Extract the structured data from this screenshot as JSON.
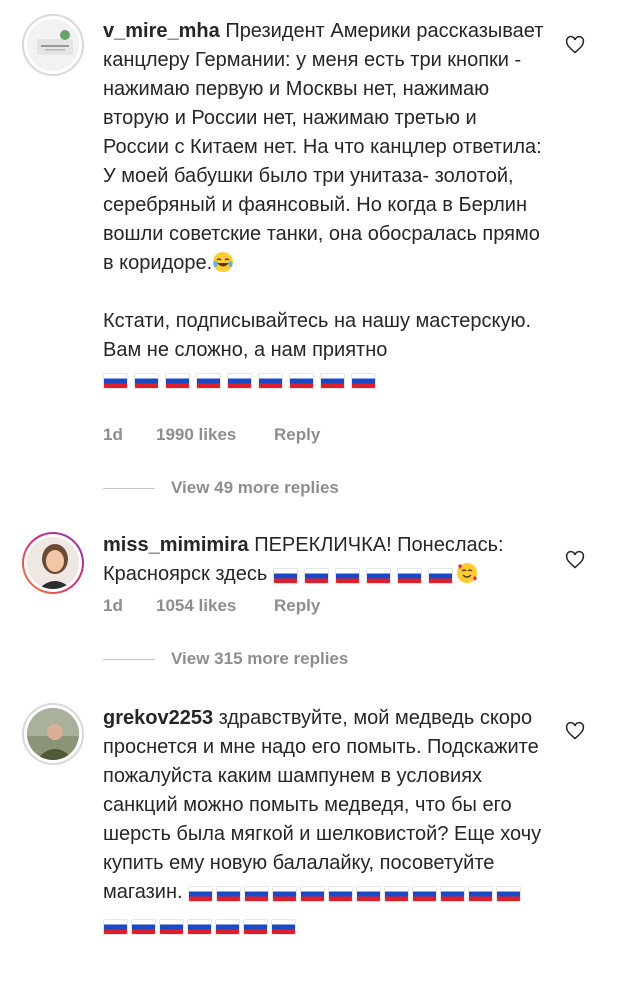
{
  "comments": [
    {
      "username": "v_mire_mha",
      "text": "Президент Америки рассказывает канцлеру Германии: у меня есть три кнопки - нажимаю первую и Москвы нет, нажимаю вторую и России нет, нажимаю третью и России с Китаем нет. На что канцлер ответила: У моей бабушки было три унитаза- золотой, серебряный и фаянсовый. Но когда в Берлин вошли советские танки, она обосралась прямо в коридоре.",
      "text2": "Кстати, подписывайтесь на нашу мастерскую. Вам не сложно, а нам приятно",
      "flag_count": 9,
      "time": "1d",
      "likes": "1990 likes",
      "reply": "Reply",
      "view_replies": "View 49 more replies"
    },
    {
      "username": "miss_mimimira",
      "text": "ПЕРЕКЛИЧКА! Понеслась: Красноярск здесь",
      "flag_count": 6,
      "time": "1d",
      "likes": "1054 likes",
      "reply": "Reply",
      "view_replies": "View 315 more replies"
    },
    {
      "username": "grekov2253",
      "text": "здравствуйте, мой медведь скоро проснется и мне надо его помыть. Подскажите пожалуйста каким шампунем в условиях санкций можно помыть медведя, что бы его шерсть была мягкой и шелковистой? Еще хочу купить ему новую балалайку, посоветуйте магазин.",
      "flag_count": 19
    }
  ],
  "colors": {
    "text": "#262626",
    "meta": "#8e8e8e",
    "flag_white": "#ffffff",
    "flag_blue": "#1a49c7",
    "flag_red": "#e01e28"
  },
  "icons": {
    "like": "heart-outline-icon",
    "laugh": "laughing-tears-emoji",
    "love": "smiling-hearts-emoji"
  }
}
